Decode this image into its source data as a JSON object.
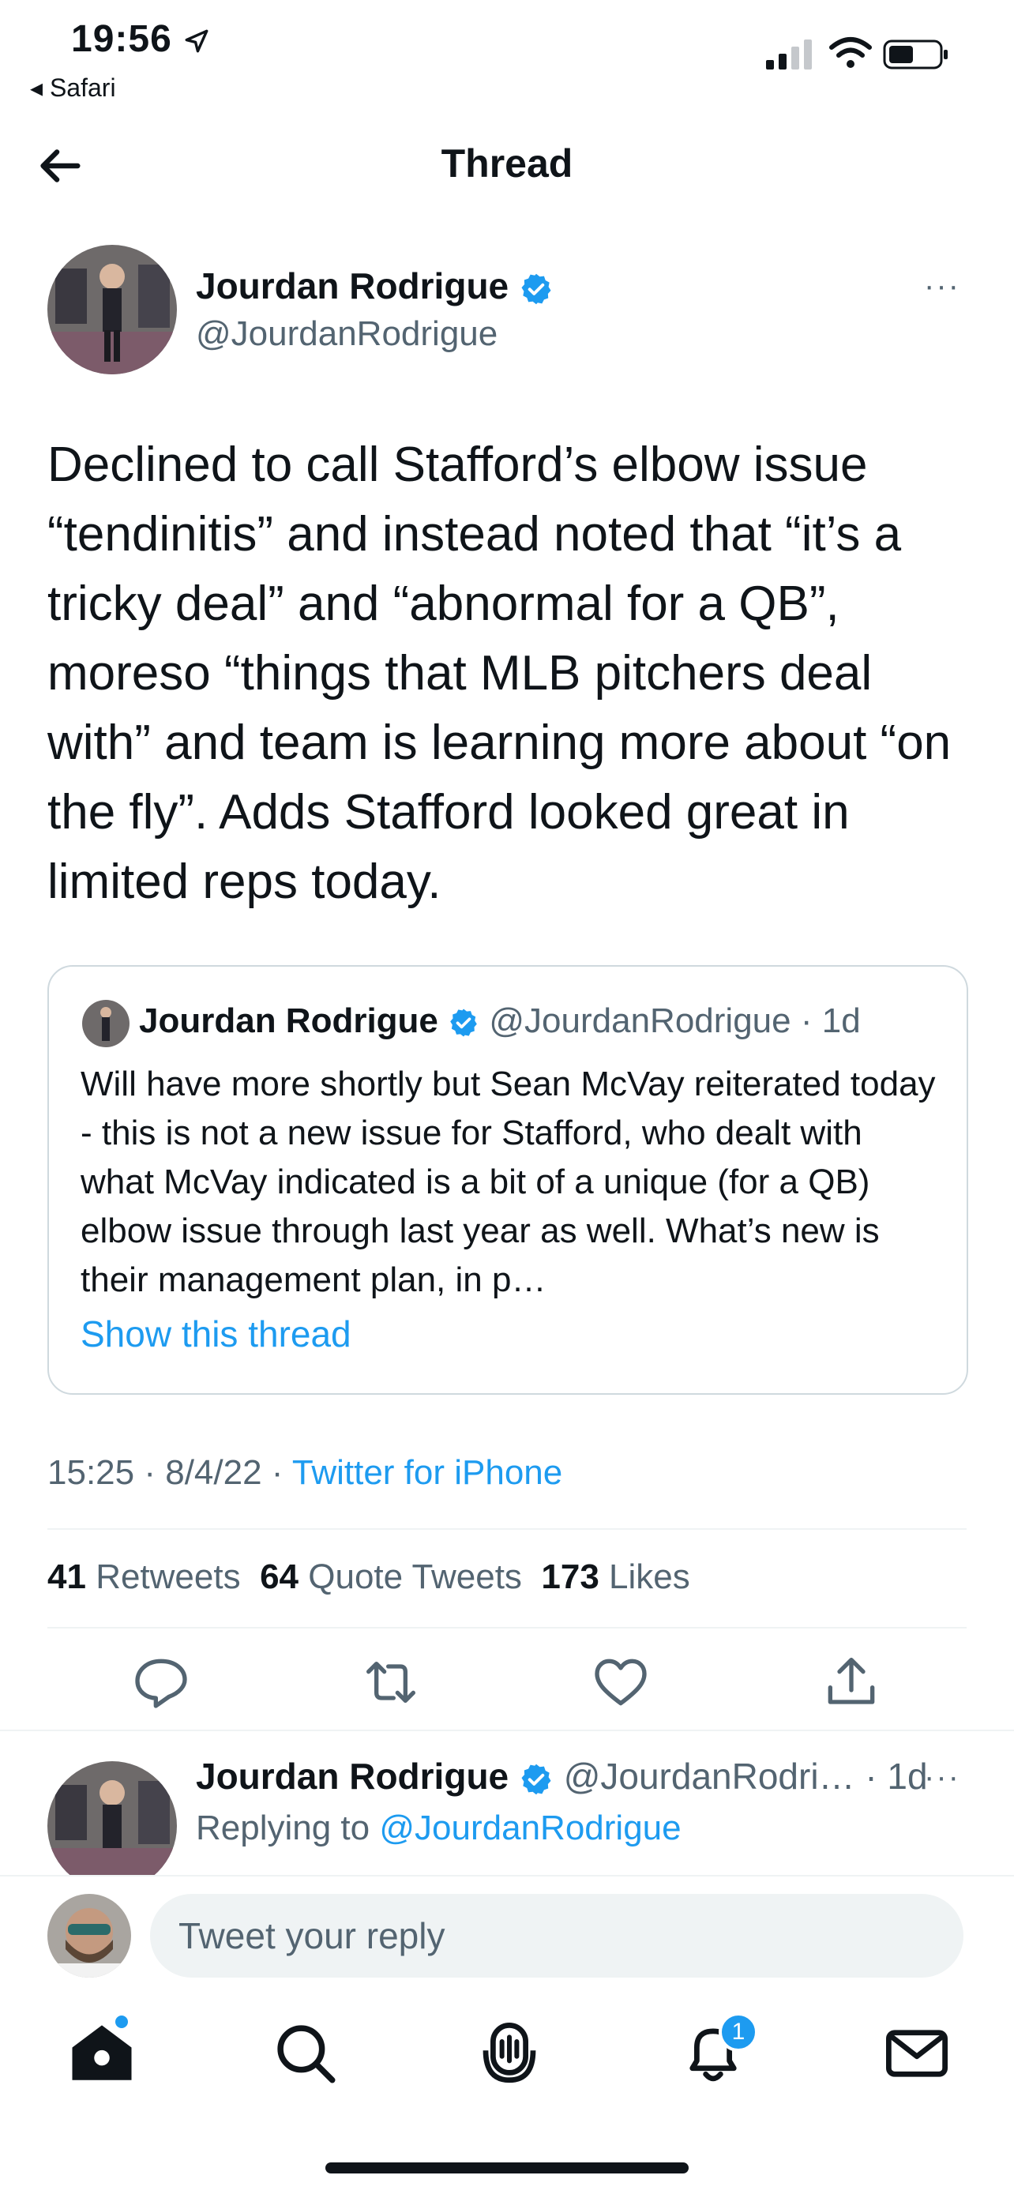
{
  "status_bar": {
    "time": "19:56",
    "back_app": "◂ Safari"
  },
  "header": {
    "title": "Thread"
  },
  "tweet": {
    "author_name": "Jourdan Rodrigue",
    "author_handle": "@JourdanRodrigue",
    "more_label": "···",
    "text": "Declined to call Stafford’s elbow issue “tendinitis” and instead noted that “it’s a tricky deal” and “abnormal for a QB”, moreso “things that MLB pitchers deal with” and team is learning more about “on the fly”. Adds Stafford looked great in limited reps today.",
    "time": "15:25",
    "date": "8/4/22",
    "separator": " · ",
    "source": "Twitter for iPhone",
    "retweets": "41",
    "retweets_label": "Retweets",
    "quote_tweets": "64",
    "quote_tweets_label": "Quote Tweets",
    "likes": "173",
    "likes_label": "Likes"
  },
  "quote": {
    "author_name": "Jourdan Rodrigue",
    "author_handle": "@JourdanRodrigue",
    "age": "· 1d",
    "text": "Will have more shortly but Sean McVay reiterated today - this is not a new issue for Stafford, who dealt with what McVay indicated is a bit of a unique (for a QB) elbow issue through last year as well. What’s new is their management plan, in p…",
    "show_thread": "Show this thread"
  },
  "reply": {
    "author_name": "Jourdan Rodrigue",
    "author_handle": "@JourdanRodri…",
    "age": "· 1d",
    "more_label": "···",
    "replying_label": "Replying to",
    "replying_handle": "@JourdanRodrigue"
  },
  "composer": {
    "placeholder": "Tweet your reply"
  },
  "tab_bar": {
    "notifications_badge": "1"
  },
  "colors": {
    "accent": "#1d9bf0",
    "text": "#0f1419",
    "muted": "#536471"
  },
  "icons": [
    "back-arrow-icon",
    "verified-icon",
    "more-icon",
    "reply-icon",
    "retweet-icon",
    "like-icon",
    "share-icon",
    "home-icon",
    "search-icon",
    "spaces-icon",
    "notifications-icon",
    "messages-icon",
    "location-arrow-icon",
    "signal-icon",
    "wifi-icon",
    "battery-icon"
  ]
}
